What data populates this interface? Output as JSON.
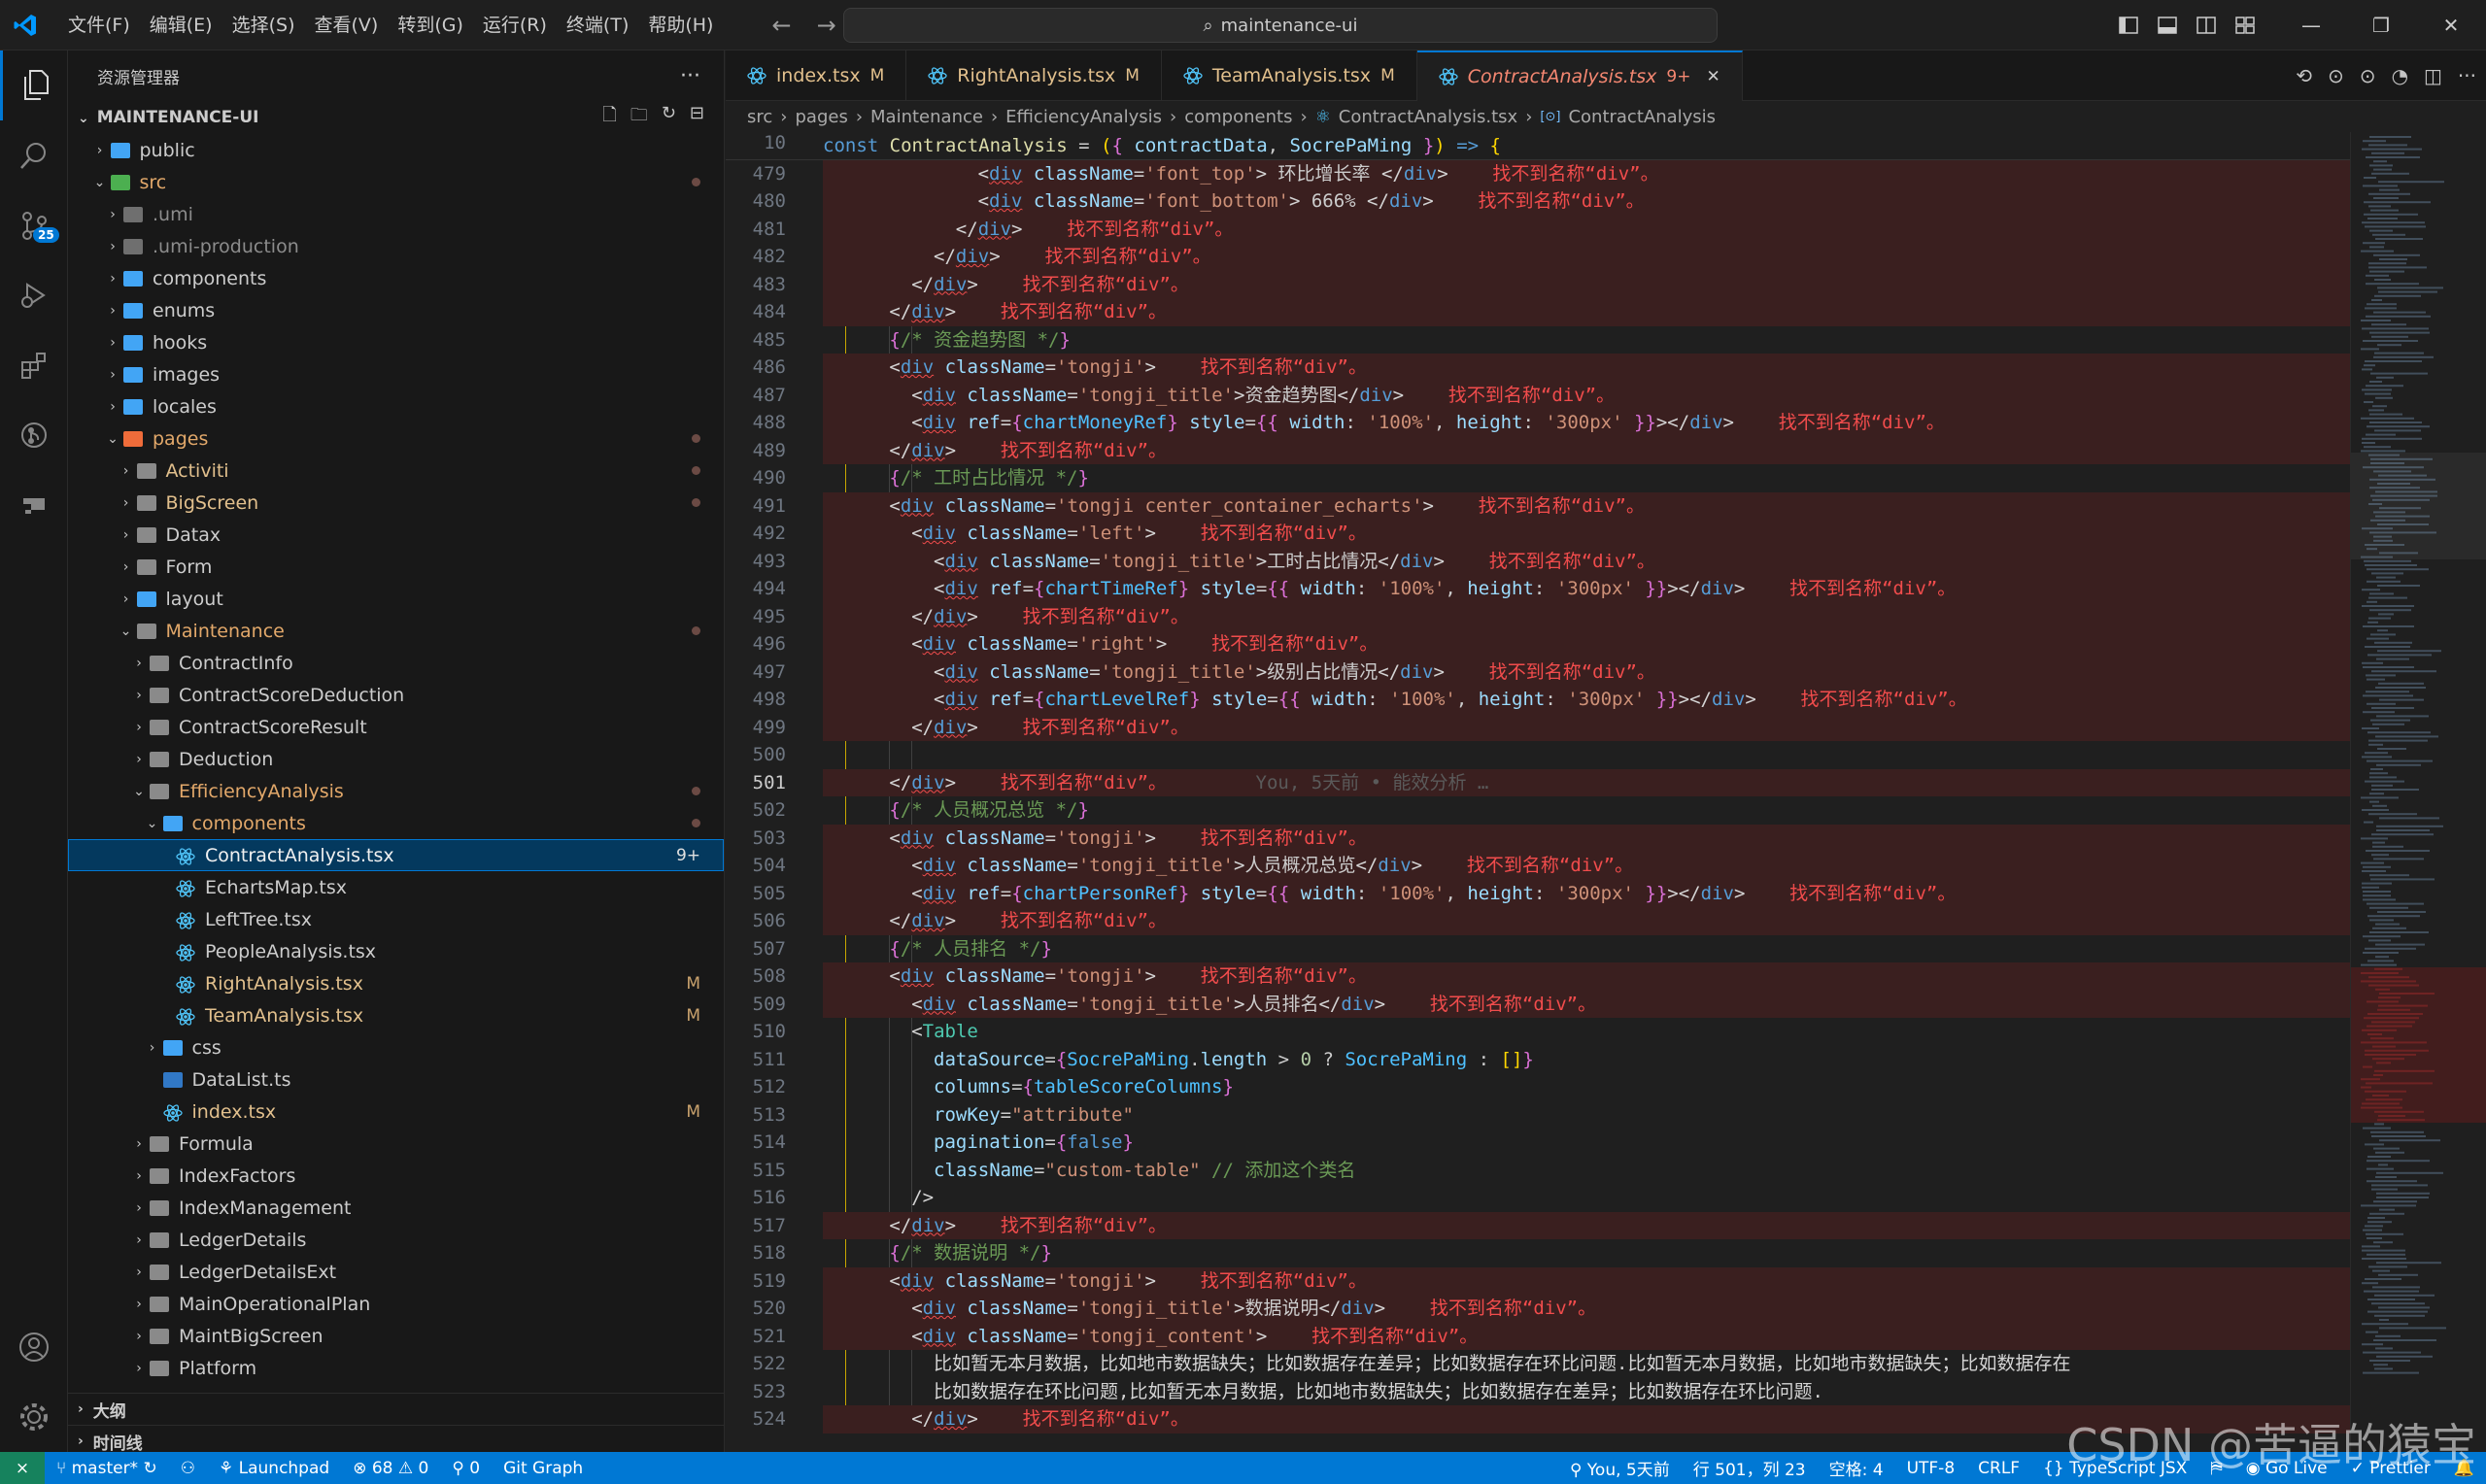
{
  "title": {
    "menus": [
      "文件(F)",
      "编辑(E)",
      "选择(S)",
      "查看(V)",
      "转到(G)",
      "运行(R)",
      "终端(T)",
      "帮助(H)"
    ],
    "search": "maintenance-ui"
  },
  "activity": {
    "scm_badge": "25"
  },
  "explorer": {
    "header": "资源管理器",
    "root": "MAINTENANCE-UI",
    "outline": "大纲",
    "timeline": "时间线",
    "items": [
      {
        "label": "public",
        "depth": 1,
        "open": false,
        "kind": "folder-special",
        "status": ""
      },
      {
        "label": "src",
        "depth": 1,
        "open": true,
        "kind": "folder-src",
        "status": "dot"
      },
      {
        "label": ".umi",
        "depth": 2,
        "open": false,
        "kind": "folder-dim",
        "status": ""
      },
      {
        "label": ".umi-production",
        "depth": 2,
        "open": false,
        "kind": "folder-dim",
        "status": ""
      },
      {
        "label": "components",
        "depth": 2,
        "open": false,
        "kind": "folder-special",
        "status": ""
      },
      {
        "label": "enums",
        "depth": 2,
        "open": false,
        "kind": "folder-special",
        "status": ""
      },
      {
        "label": "hooks",
        "depth": 2,
        "open": false,
        "kind": "folder-special",
        "status": ""
      },
      {
        "label": "images",
        "depth": 2,
        "open": false,
        "kind": "folder-special",
        "status": ""
      },
      {
        "label": "locales",
        "depth": 2,
        "open": false,
        "kind": "folder-special",
        "status": ""
      },
      {
        "label": "pages",
        "depth": 2,
        "open": true,
        "kind": "folder-pages",
        "status": "dot"
      },
      {
        "label": "Activiti",
        "depth": 3,
        "open": false,
        "kind": "folder",
        "status": "dot"
      },
      {
        "label": "BigScreen",
        "depth": 3,
        "open": false,
        "kind": "folder",
        "status": "dot"
      },
      {
        "label": "Datax",
        "depth": 3,
        "open": false,
        "kind": "folder",
        "status": ""
      },
      {
        "label": "Form",
        "depth": 3,
        "open": false,
        "kind": "folder",
        "status": ""
      },
      {
        "label": "layout",
        "depth": 3,
        "open": false,
        "kind": "folder-special",
        "status": ""
      },
      {
        "label": "Maintenance",
        "depth": 3,
        "open": true,
        "kind": "folder",
        "status": "dot"
      },
      {
        "label": "ContractInfo",
        "depth": 4,
        "open": false,
        "kind": "folder",
        "status": ""
      },
      {
        "label": "ContractScoreDeduction",
        "depth": 4,
        "open": false,
        "kind": "folder",
        "status": ""
      },
      {
        "label": "ContractScoreResult",
        "depth": 4,
        "open": false,
        "kind": "folder",
        "status": ""
      },
      {
        "label": "Deduction",
        "depth": 4,
        "open": false,
        "kind": "folder",
        "status": ""
      },
      {
        "label": "EfficiencyAnalysis",
        "depth": 4,
        "open": true,
        "kind": "folder",
        "status": "dot"
      },
      {
        "label": "components",
        "depth": 5,
        "open": true,
        "kind": "folder-special",
        "status": "dot"
      },
      {
        "label": "ContractAnalysis.tsx",
        "depth": 6,
        "open": null,
        "kind": "react",
        "status": "9+",
        "selected": true
      },
      {
        "label": "EchartsMap.tsx",
        "depth": 6,
        "open": null,
        "kind": "react",
        "status": ""
      },
      {
        "label": "LeftTree.tsx",
        "depth": 6,
        "open": null,
        "kind": "react",
        "status": ""
      },
      {
        "label": "PeopleAnalysis.tsx",
        "depth": 6,
        "open": null,
        "kind": "react",
        "status": ""
      },
      {
        "label": "RightAnalysis.tsx",
        "depth": 6,
        "open": null,
        "kind": "react",
        "status": "M"
      },
      {
        "label": "TeamAnalysis.tsx",
        "depth": 6,
        "open": null,
        "kind": "react",
        "status": "M"
      },
      {
        "label": "css",
        "depth": 5,
        "open": false,
        "kind": "folder-special",
        "status": ""
      },
      {
        "label": "DataList.ts",
        "depth": 5,
        "open": null,
        "kind": "ts",
        "status": ""
      },
      {
        "label": "index.tsx",
        "depth": 5,
        "open": null,
        "kind": "react",
        "status": "M"
      },
      {
        "label": "Formula",
        "depth": 4,
        "open": false,
        "kind": "folder",
        "status": ""
      },
      {
        "label": "IndexFactors",
        "depth": 4,
        "open": false,
        "kind": "folder",
        "status": ""
      },
      {
        "label": "IndexManagement",
        "depth": 4,
        "open": false,
        "kind": "folder",
        "status": ""
      },
      {
        "label": "LedgerDetails",
        "depth": 4,
        "open": false,
        "kind": "folder",
        "status": ""
      },
      {
        "label": "LedgerDetailsExt",
        "depth": 4,
        "open": false,
        "kind": "folder",
        "status": ""
      },
      {
        "label": "MainOperationalPlan",
        "depth": 4,
        "open": false,
        "kind": "folder",
        "status": ""
      },
      {
        "label": "MaintBigScreen",
        "depth": 4,
        "open": false,
        "kind": "folder",
        "status": ""
      },
      {
        "label": "Platform",
        "depth": 4,
        "open": false,
        "kind": "folder",
        "status": ""
      }
    ]
  },
  "tabs": [
    {
      "label": "index.tsx",
      "status": "M",
      "active": false
    },
    {
      "label": "RightAnalysis.tsx",
      "status": "M",
      "active": false
    },
    {
      "label": "TeamAnalysis.tsx",
      "status": "M",
      "active": false
    },
    {
      "label": "ContractAnalysis.tsx",
      "status": "9+",
      "active": true
    }
  ],
  "breadcrumb": [
    "src",
    "pages",
    "Maintenance",
    "EfficiencyAnalysis",
    "components",
    "ContractAnalysis.tsx",
    "ContractAnalysis"
  ],
  "sticky": {
    "line": "10",
    "text": "const ContractAnalysis = ({ contractData, SocrePaMing }) => {"
  },
  "code": {
    "first_line": 479,
    "current_line": 501,
    "err": "找不到名称“div”。"
  },
  "status": {
    "branch": "master*",
    "launchpad": "Launchpad",
    "errors": "68",
    "warnings": "0",
    "ports": "0",
    "git_graph": "Git Graph",
    "blame": "You, 5天前",
    "position": "行 501，列 23",
    "spaces": "空格: 4",
    "encoding": "UTF-8",
    "eol": "CRLF",
    "language": "TypeScript JSX",
    "golive": "Go Live",
    "prettier": "Prettier"
  },
  "watermark": "CSDN @苦逼的猿宝"
}
